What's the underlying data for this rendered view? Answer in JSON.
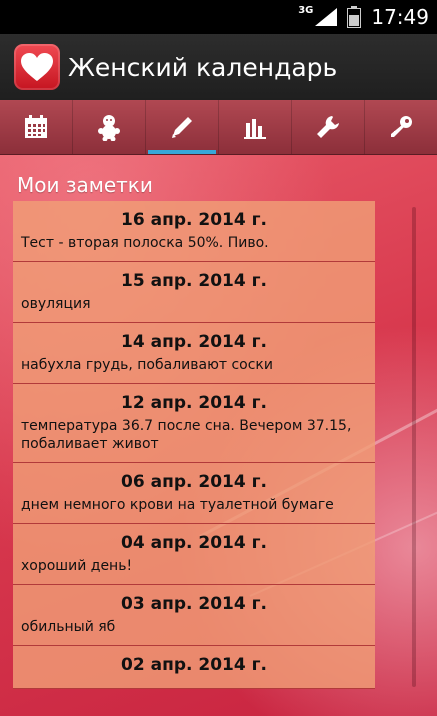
{
  "status_bar": {
    "network": "3G",
    "time": "17:49"
  },
  "app": {
    "title": "Женский календарь"
  },
  "tabs": [
    {
      "name": "calendar-icon",
      "active": false
    },
    {
      "name": "baby-icon",
      "active": false
    },
    {
      "name": "pencil-icon",
      "active": true
    },
    {
      "name": "chart-icon",
      "active": false
    },
    {
      "name": "wrench-icon",
      "active": false
    },
    {
      "name": "key-icon",
      "active": false
    }
  ],
  "notes": {
    "title": "Мои заметки",
    "items": [
      {
        "date": "16 апр. 2014 г.",
        "text": "Тест - вторая полоска 50%. Пиво."
      },
      {
        "date": "15 апр. 2014 г.",
        "text": "овуляция"
      },
      {
        "date": "14 апр. 2014 г.",
        "text": "набухла грудь, побаливают соски"
      },
      {
        "date": "12 апр. 2014 г.",
        "text": "температура 36.7 после сна. Вечером 37.15, побаливает живот"
      },
      {
        "date": "06 апр. 2014 г.",
        "text": "днем немного крови на туалетной бумаге"
      },
      {
        "date": "04 апр. 2014 г.",
        "text": "хороший день!"
      },
      {
        "date": "03 апр. 2014 г.",
        "text": "обильный яб"
      },
      {
        "date": "02 апр. 2014 г.",
        "text": ""
      }
    ]
  },
  "colors": {
    "active_tab_indicator": "#37a8d8",
    "note_background": "#f09e76",
    "accent": "#d8394e"
  }
}
